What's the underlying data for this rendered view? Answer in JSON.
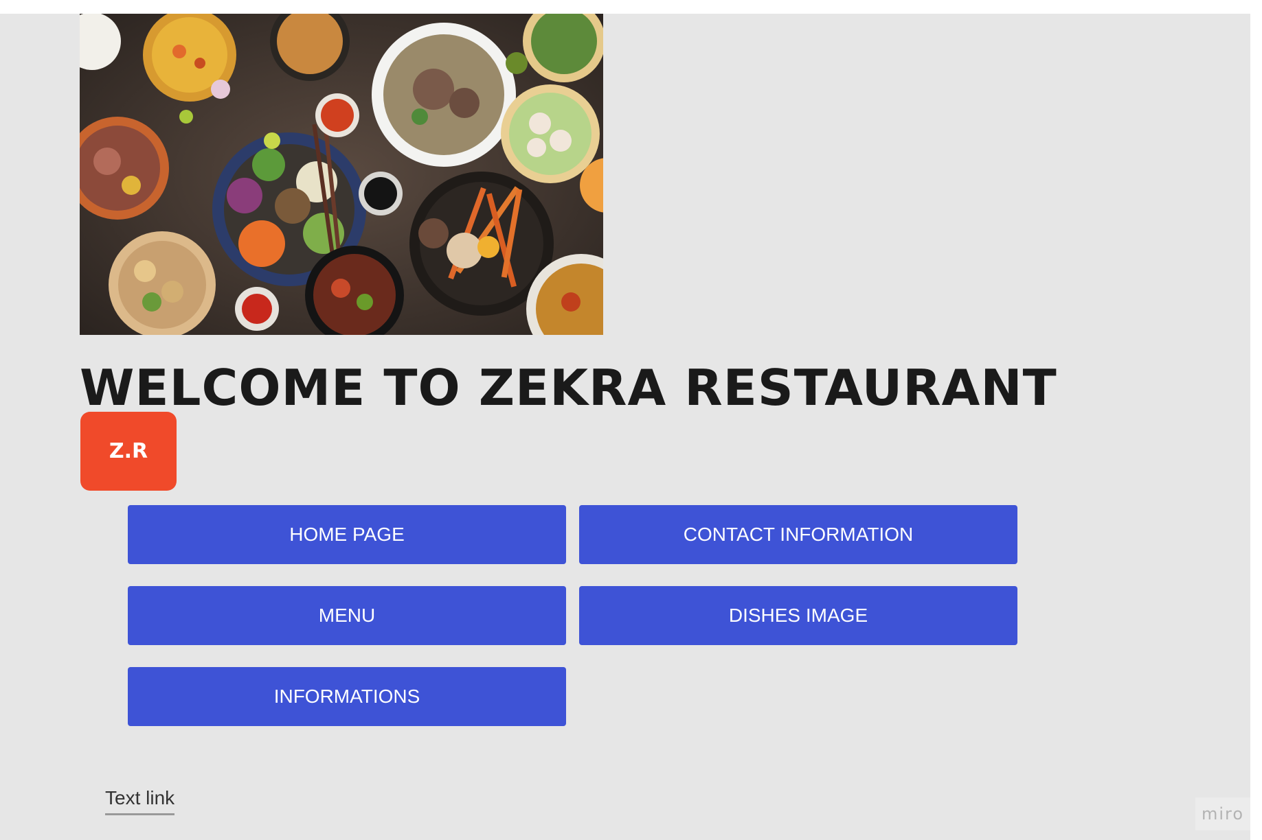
{
  "hero": {
    "image_alt": "Assorted Asian dishes on a dark table"
  },
  "header": {
    "title": "WELCOME TO ZEKRA RESTAURANT"
  },
  "logo": {
    "text": "Z.R",
    "color": "#f04a2a"
  },
  "nav": {
    "button_color": "#3e53d6",
    "home_label": "HOME PAGE",
    "contact_label": "CONTACT INFORMATION",
    "menu_label": "MENU",
    "dishes_label": "DISHES IMAGE",
    "info_label": "INFORMATIONS"
  },
  "footer": {
    "link_text": "Text link"
  },
  "watermark": {
    "text": "miro"
  }
}
